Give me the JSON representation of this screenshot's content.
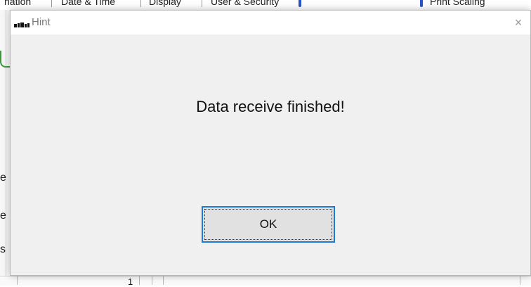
{
  "background": {
    "tabs": [
      "nation",
      "Date & Time",
      "Display",
      "User & Security",
      "Print Scaling"
    ],
    "bottom_cell_value": "1",
    "left_chars": [
      "e",
      "e",
      "s",
      "-"
    ]
  },
  "dialog": {
    "title": "Hint",
    "message": "Data receive finished!",
    "ok_label": "OK",
    "close_glyph": "×",
    "icon": "app-logo-icon"
  },
  "colors": {
    "ok_border": "#1e7ad2",
    "dialog_bg": "#f0f0f0",
    "titlebar_bg": "#ffffff"
  }
}
